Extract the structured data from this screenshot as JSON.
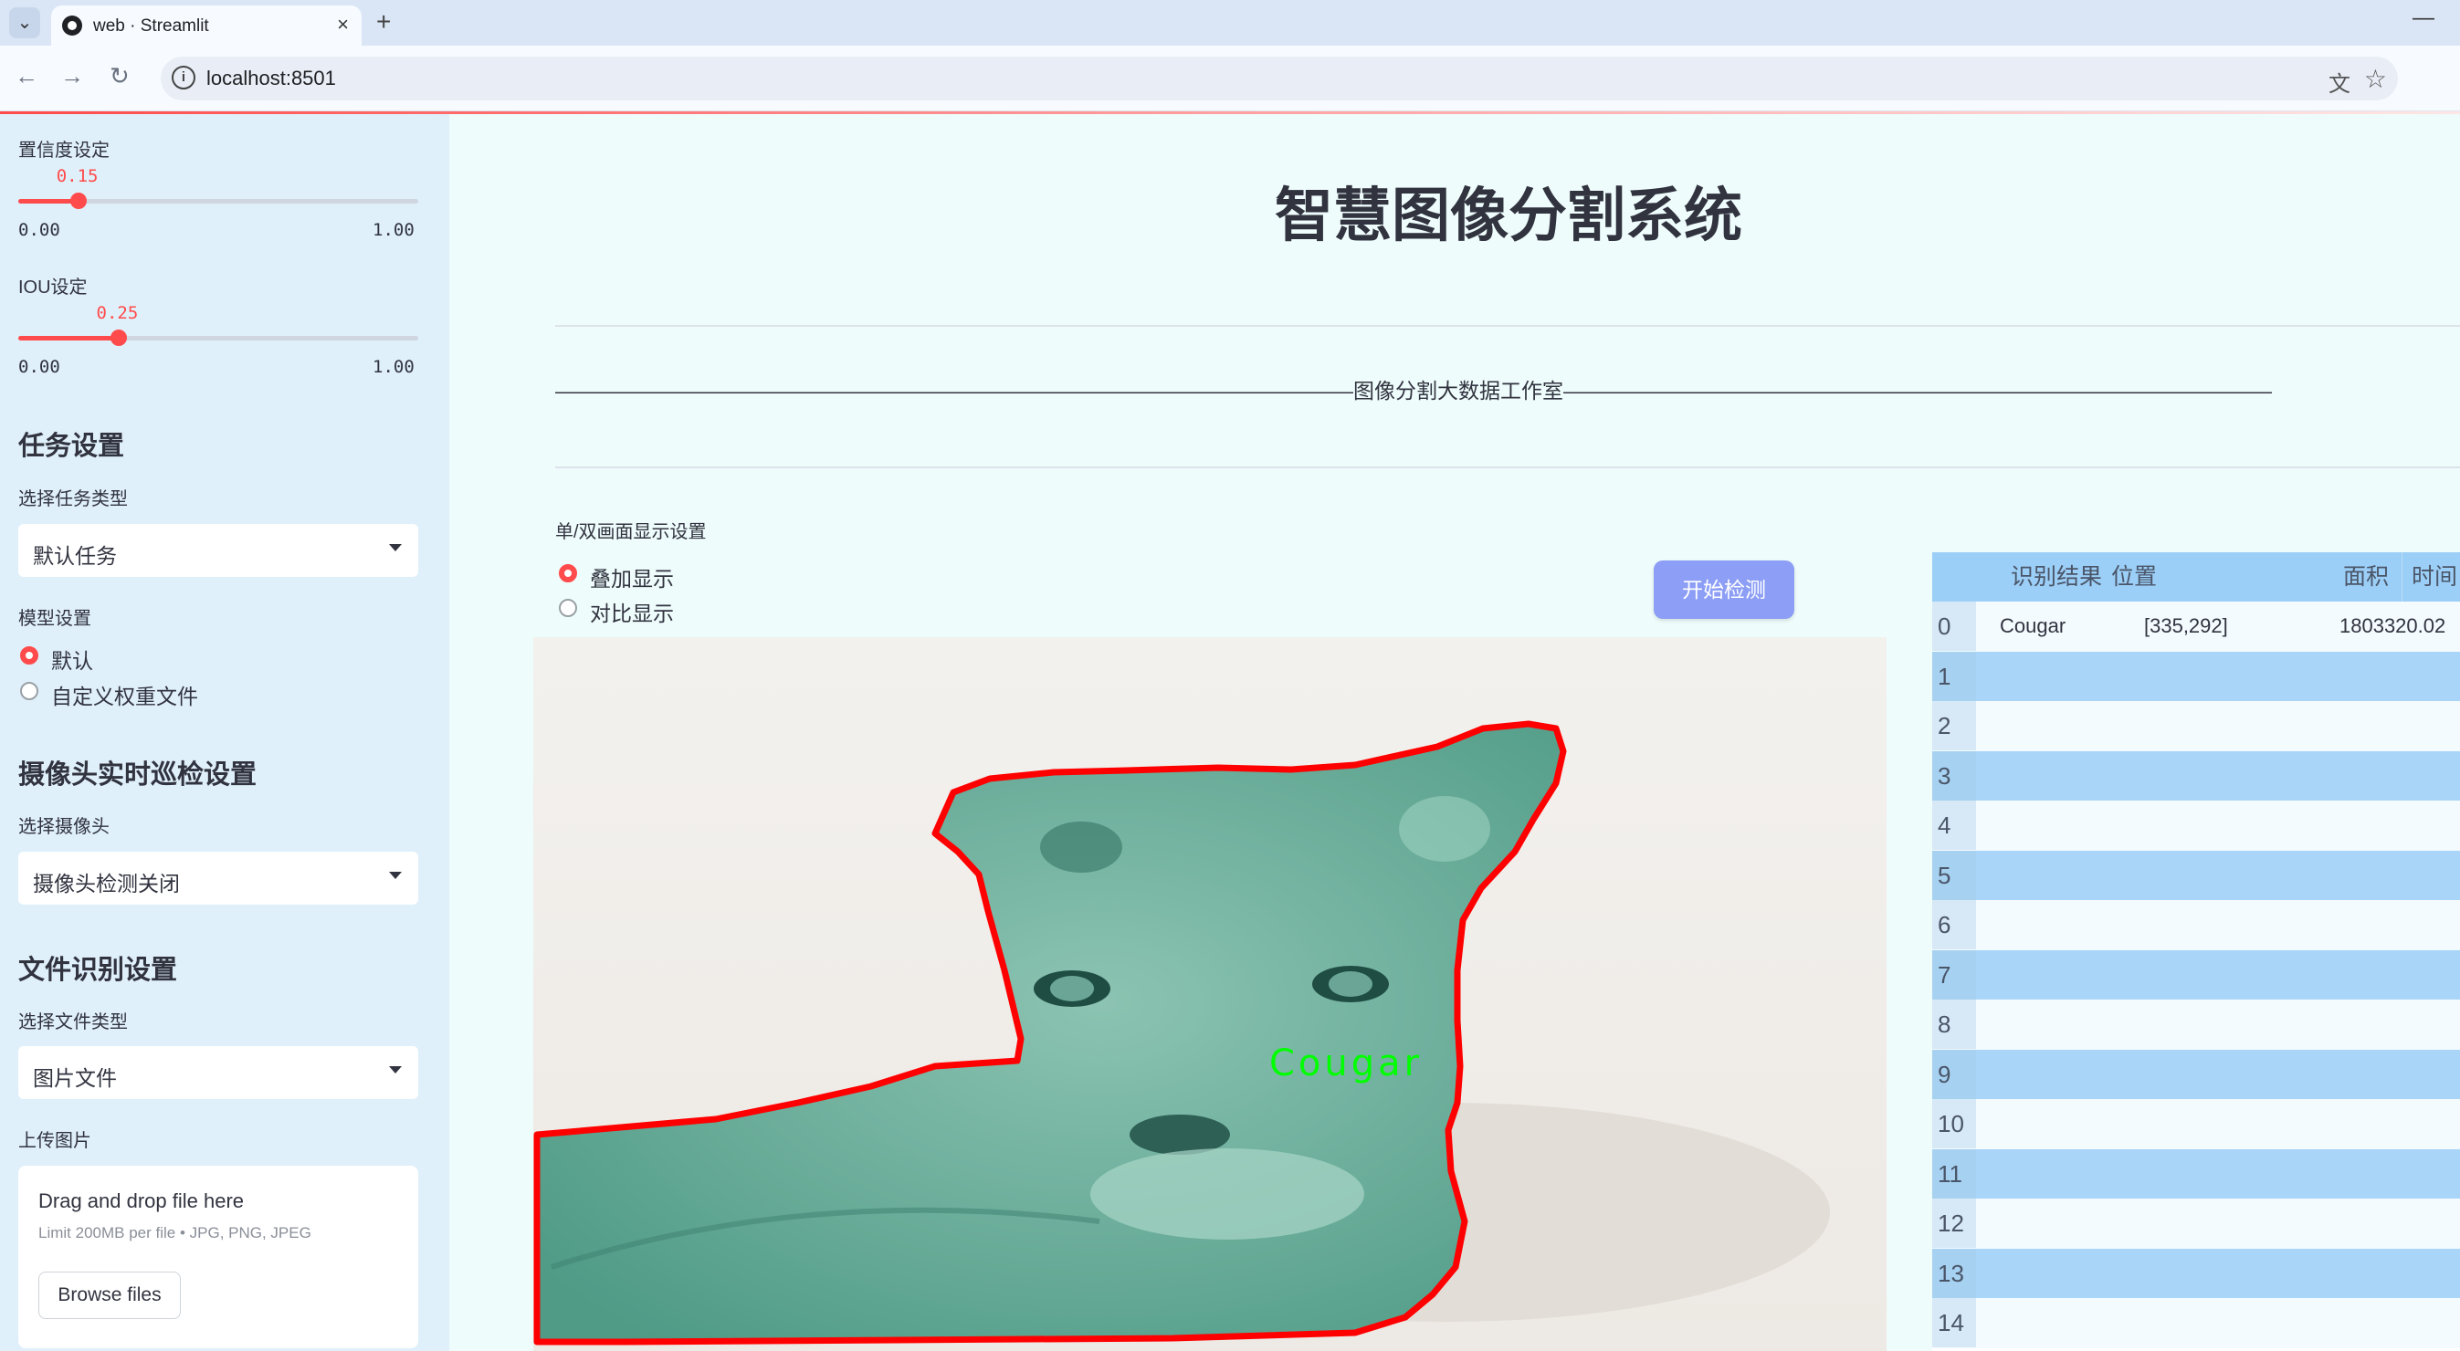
{
  "browser": {
    "tab_title": "web · Streamlit",
    "url": "localhost:8501"
  },
  "sidebar": {
    "confidence": {
      "label": "置信度设定",
      "value": "0.15",
      "value_fraction": 0.15,
      "min": "0.00",
      "max": "1.00"
    },
    "iou": {
      "label": "IOU设定",
      "value": "0.25",
      "value_fraction": 0.25,
      "min": "0.00",
      "max": "1.00"
    },
    "task_section": "任务设置",
    "task_type_label": "选择任务类型",
    "task_type_value": "默认任务",
    "model_label": "模型设置",
    "model_options": [
      "默认",
      "自定义权重文件"
    ],
    "camera_section": "摄像头实时巡检设置",
    "camera_label": "选择摄像头",
    "camera_value": "摄像头检测关闭",
    "file_section": "文件识别设置",
    "file_type_label": "选择文件类型",
    "file_type_value": "图片文件",
    "upload_label": "上传图片",
    "upload_title": "Drag and drop file here",
    "upload_limit": "Limit 200MB per file • JPG, PNG, JPEG",
    "browse_label": "Browse files"
  },
  "main": {
    "title": "智慧图像分割系统",
    "studio_line": "——————————————————————————————————————图像分割大数据工作室——————————————————————————————————————",
    "display_label": "单/双画面显示设置",
    "display_options": [
      "叠加显示",
      "对比显示"
    ],
    "start_button": "开始检测",
    "detection_label": "Cougar"
  },
  "table": {
    "headers": [
      "识别结果",
      "位置",
      "面积",
      "时间"
    ],
    "rows": [
      {
        "index": "0",
        "result": "Cougar",
        "position": "[335,292]",
        "area": "1803320.02"
      },
      {
        "index": "1"
      },
      {
        "index": "2"
      },
      {
        "index": "3"
      },
      {
        "index": "4"
      },
      {
        "index": "5"
      },
      {
        "index": "6"
      },
      {
        "index": "7"
      },
      {
        "index": "8"
      },
      {
        "index": "9"
      },
      {
        "index": "10"
      },
      {
        "index": "11"
      },
      {
        "index": "12"
      },
      {
        "index": "13"
      },
      {
        "index": "14"
      }
    ]
  },
  "colors": {
    "accent": "#ff4b4b",
    "button": "#8c9ef5",
    "table_header": "#9ccff7",
    "mask": "#3fa58f",
    "outline": "#ff0000",
    "label": "#00ff00"
  }
}
